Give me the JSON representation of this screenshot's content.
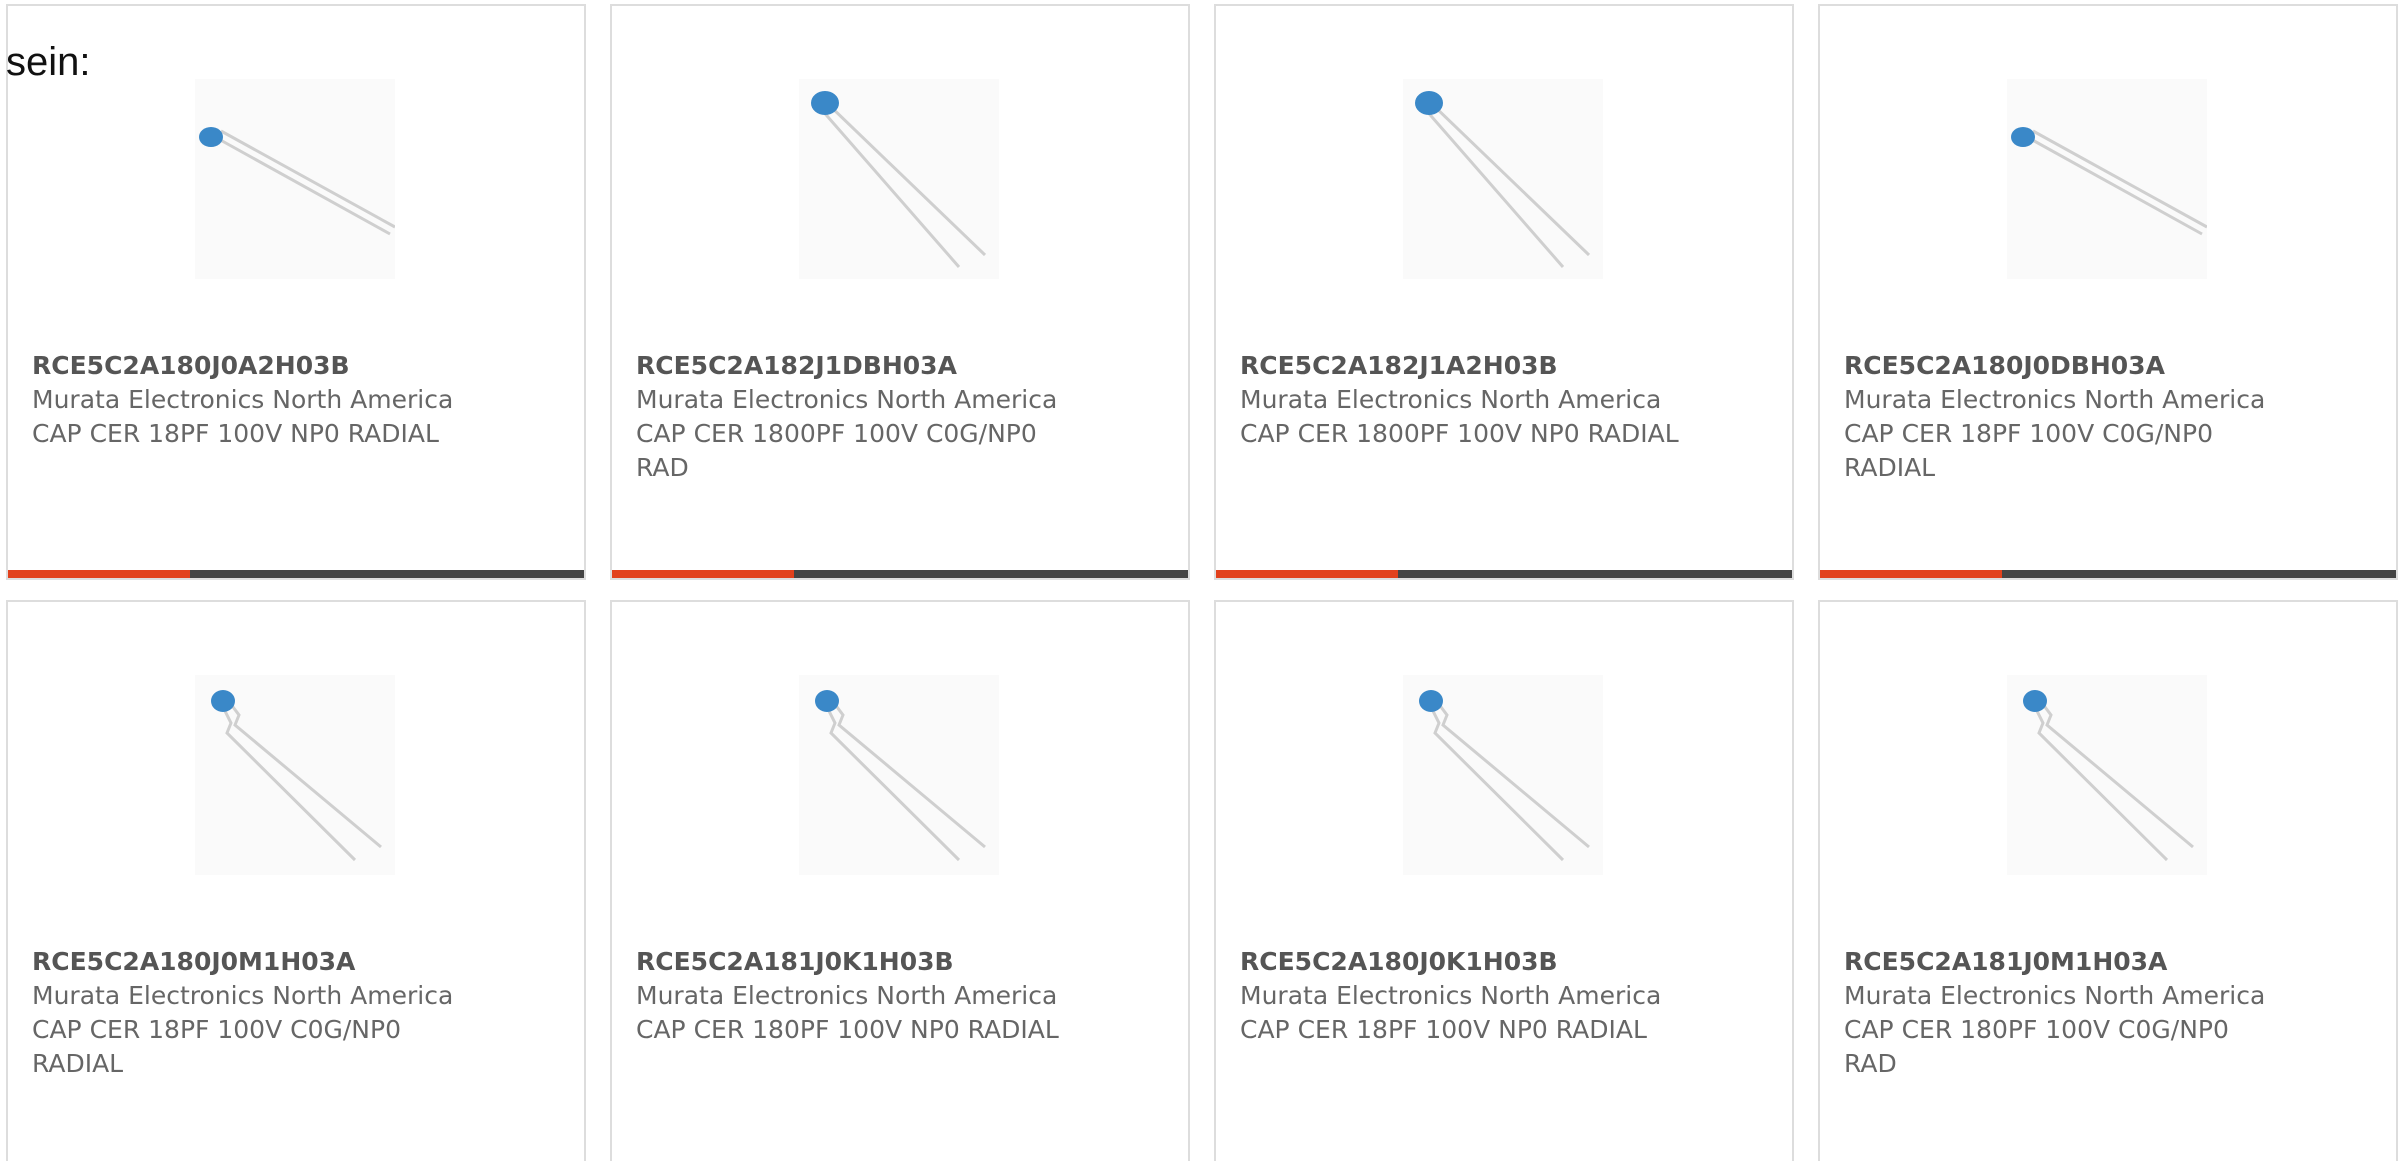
{
  "lead_text": "sein:",
  "colors": {
    "accent": "#e2411c",
    "bar": "#444444",
    "border": "#dddddd",
    "capacitor_blue": "#3a88c8"
  },
  "products": [
    {
      "part_number": "RCE5C2A180J0A2H03B",
      "manufacturer": "Murata Electronics North America",
      "description": "CAP CER 18PF 100V NP0 RADIAL",
      "image": "capacitor-long-lead-icon"
    },
    {
      "part_number": "RCE5C2A182J1DBH03A",
      "manufacturer": "Murata Electronics North America",
      "description": "CAP CER 1800PF 100V C0G/NP0 RAD",
      "image": "capacitor-radial-icon"
    },
    {
      "part_number": "RCE5C2A182J1A2H03B",
      "manufacturer": "Murata Electronics North America",
      "description": "CAP CER 1800PF 100V NP0 RADIAL",
      "image": "capacitor-radial-icon"
    },
    {
      "part_number": "RCE5C2A180J0DBH03A",
      "manufacturer": "Murata Electronics North America",
      "description": "CAP CER 18PF 100V C0G/NP0 RADIAL",
      "image": "capacitor-long-lead-icon"
    },
    {
      "part_number": "RCE5C2A180J0M1H03A",
      "manufacturer": "Murata Electronics North America",
      "description": "CAP CER 18PF 100V C0G/NP0 RADIAL",
      "image": "capacitor-kinked-lead-icon"
    },
    {
      "part_number": "RCE5C2A181J0K1H03B",
      "manufacturer": "Murata Electronics North America",
      "description": "CAP CER 180PF 100V NP0 RADIAL",
      "image": "capacitor-kinked-lead-icon"
    },
    {
      "part_number": "RCE5C2A180J0K1H03B",
      "manufacturer": "Murata Electronics North America",
      "description": "CAP CER 18PF 100V NP0 RADIAL",
      "image": "capacitor-kinked-lead-icon"
    },
    {
      "part_number": "RCE5C2A181J0M1H03A",
      "manufacturer": "Murata Electronics North America",
      "description": "CAP CER 180PF 100V C0G/NP0 RAD",
      "image": "capacitor-kinked-lead-icon"
    }
  ]
}
